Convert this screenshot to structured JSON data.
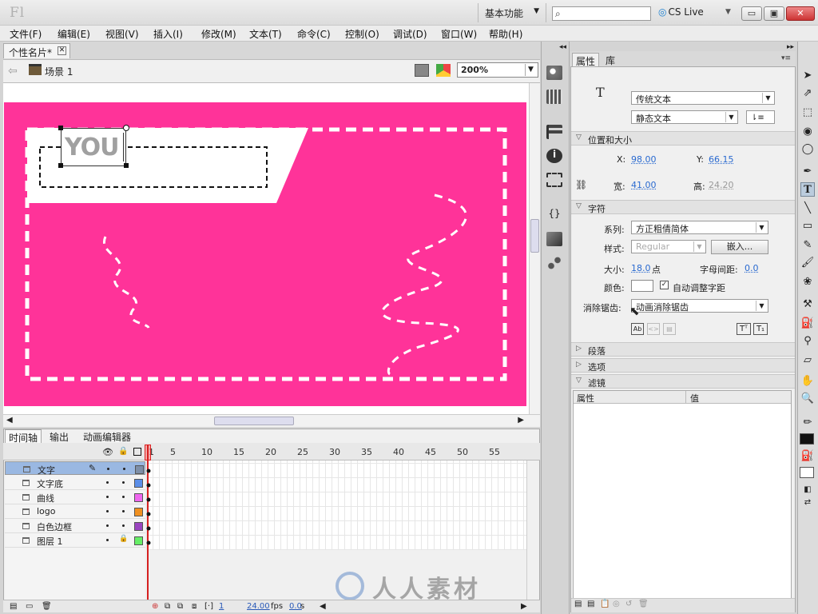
{
  "app": {
    "logo": "Fl",
    "workspace": "基本功能",
    "cs_live": "CS Live"
  },
  "menu": [
    "文件(F)",
    "编辑(E)",
    "视图(V)",
    "插入(I)",
    "修改(M)",
    "文本(T)",
    "命令(C)",
    "控制(O)",
    "调试(D)",
    "窗口(W)",
    "帮助(H)"
  ],
  "document": {
    "tab": "个性名片*",
    "scene": "场景 1",
    "zoom": "200%",
    "text_box": "YOU"
  },
  "timeline": {
    "tabs": [
      "时间轴",
      "输出",
      "动画编辑器"
    ],
    "frame_numbers": [
      "1",
      "5",
      "10",
      "15",
      "20",
      "25",
      "30",
      "35",
      "40",
      "45",
      "50",
      "55"
    ],
    "layers": [
      {
        "name": "文字",
        "color": "#7e8fa8",
        "selected": true
      },
      {
        "name": "文字底",
        "color": "#5b8ee8"
      },
      {
        "name": "曲线",
        "color": "#ee66ee"
      },
      {
        "name": "logo",
        "color": "#f09020"
      },
      {
        "name": "白色边框",
        "color": "#9a44c0"
      },
      {
        "name": "图层 1",
        "color": "#66ee66",
        "locked": true
      }
    ],
    "status": {
      "frame": "1",
      "fps": "24.00",
      "fps_unit": "fps",
      "time": "0.0",
      "time_unit": "s"
    }
  },
  "watermark": "人人素材",
  "properties": {
    "tabs": [
      "属性",
      "库"
    ],
    "text_engine": "传统文本",
    "text_type": "静态文本",
    "pos_section": "位置和大小",
    "x_label": "X:",
    "x": "98.00",
    "y_label": "Y:",
    "y": "66.15",
    "w_label": "宽:",
    "w": "41.00",
    "h_label": "高:",
    "h": "24.20",
    "char_section": "字符",
    "family_label": "系列:",
    "family": "方正粗倩简体",
    "style_label": "样式:",
    "style": "Regular",
    "embed": "嵌入...",
    "size_label": "大小:",
    "size": "18.0",
    "size_unit": "点",
    "spacing_label": "字母间距:",
    "spacing": "0.0",
    "color_label": "颜色:",
    "auto_kern": "自动调整字距",
    "aa_label": "消除锯齿:",
    "aa": "动画消除锯齿",
    "para_section": "段落",
    "options_section": "选项",
    "filters_section": "滤镜",
    "filter_col1": "属性",
    "filter_col2": "值"
  }
}
